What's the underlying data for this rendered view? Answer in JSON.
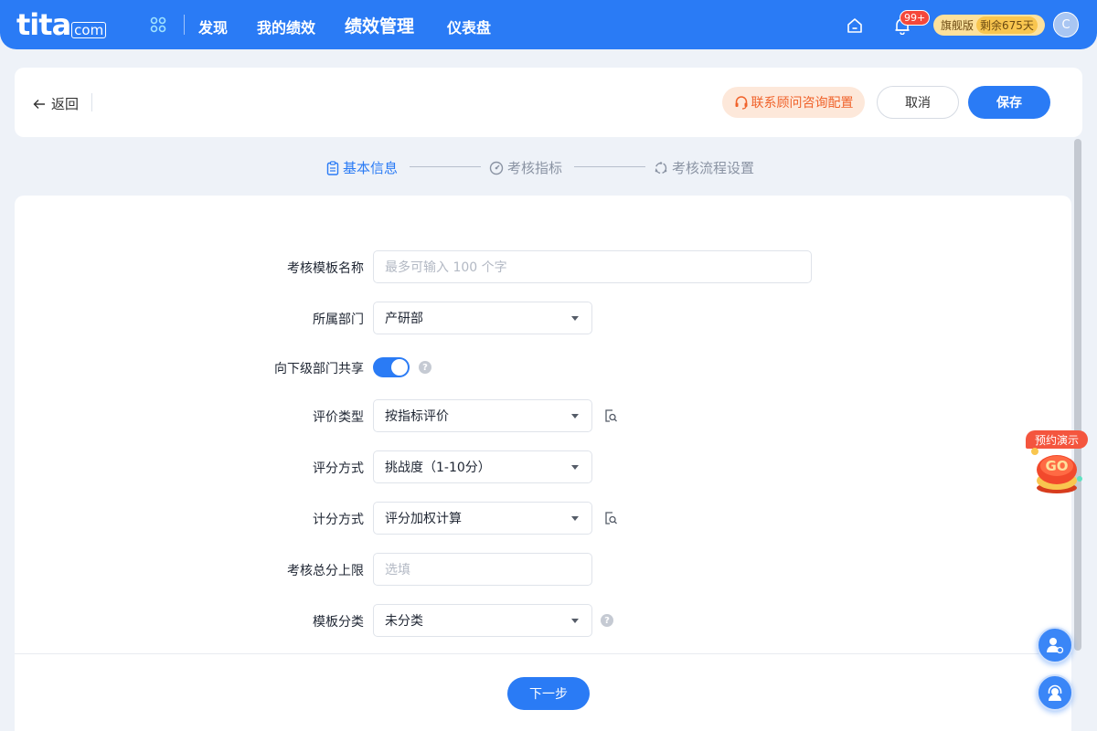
{
  "brand": {
    "logo_main": "tita",
    "logo_domain": "com"
  },
  "nav": {
    "items": [
      {
        "label": "发现"
      },
      {
        "label": "我的绩效"
      },
      {
        "label": "绩效管理"
      },
      {
        "label": "仪表盘"
      }
    ],
    "active_index": 2
  },
  "header": {
    "notification_badge": "99+",
    "edition_label": "旗舰版",
    "edition_days": "剩余675天",
    "avatar_initial": "C"
  },
  "toolbar": {
    "back_label": "返回",
    "contact_label": "联系顾问咨询配置",
    "cancel_label": "取消",
    "save_label": "保存"
  },
  "steps": [
    {
      "label": "基本信息",
      "state": "active"
    },
    {
      "label": "考核指标",
      "state": "pending"
    },
    {
      "label": "考核流程设置",
      "state": "pending"
    }
  ],
  "form": {
    "template_name": {
      "label": "考核模板名称",
      "placeholder": "最多可输入 100 个字"
    },
    "department": {
      "label": "所属部门",
      "value": "产研部"
    },
    "share_sub_dept": {
      "label": "向下级部门共享",
      "enabled": true
    },
    "eval_type": {
      "label": "评价类型",
      "value": "按指标评价"
    },
    "score_method": {
      "label": "评分方式",
      "value": "挑战度（1-10分）"
    },
    "calc_method": {
      "label": "计分方式",
      "value": "评分加权计算"
    },
    "score_limit": {
      "label": "考核总分上限",
      "placeholder": "选填"
    },
    "template_category": {
      "label": "模板分类",
      "value": "未分类"
    }
  },
  "footer": {
    "next_label": "下一步"
  },
  "floating": {
    "demo_label": "预约演示",
    "go_label": "GO"
  },
  "colors": {
    "primary": "#2a7bf5",
    "contact_text": "#f0622a",
    "contact_bg": "#fde8da",
    "edition_bg": "#fde19c"
  }
}
